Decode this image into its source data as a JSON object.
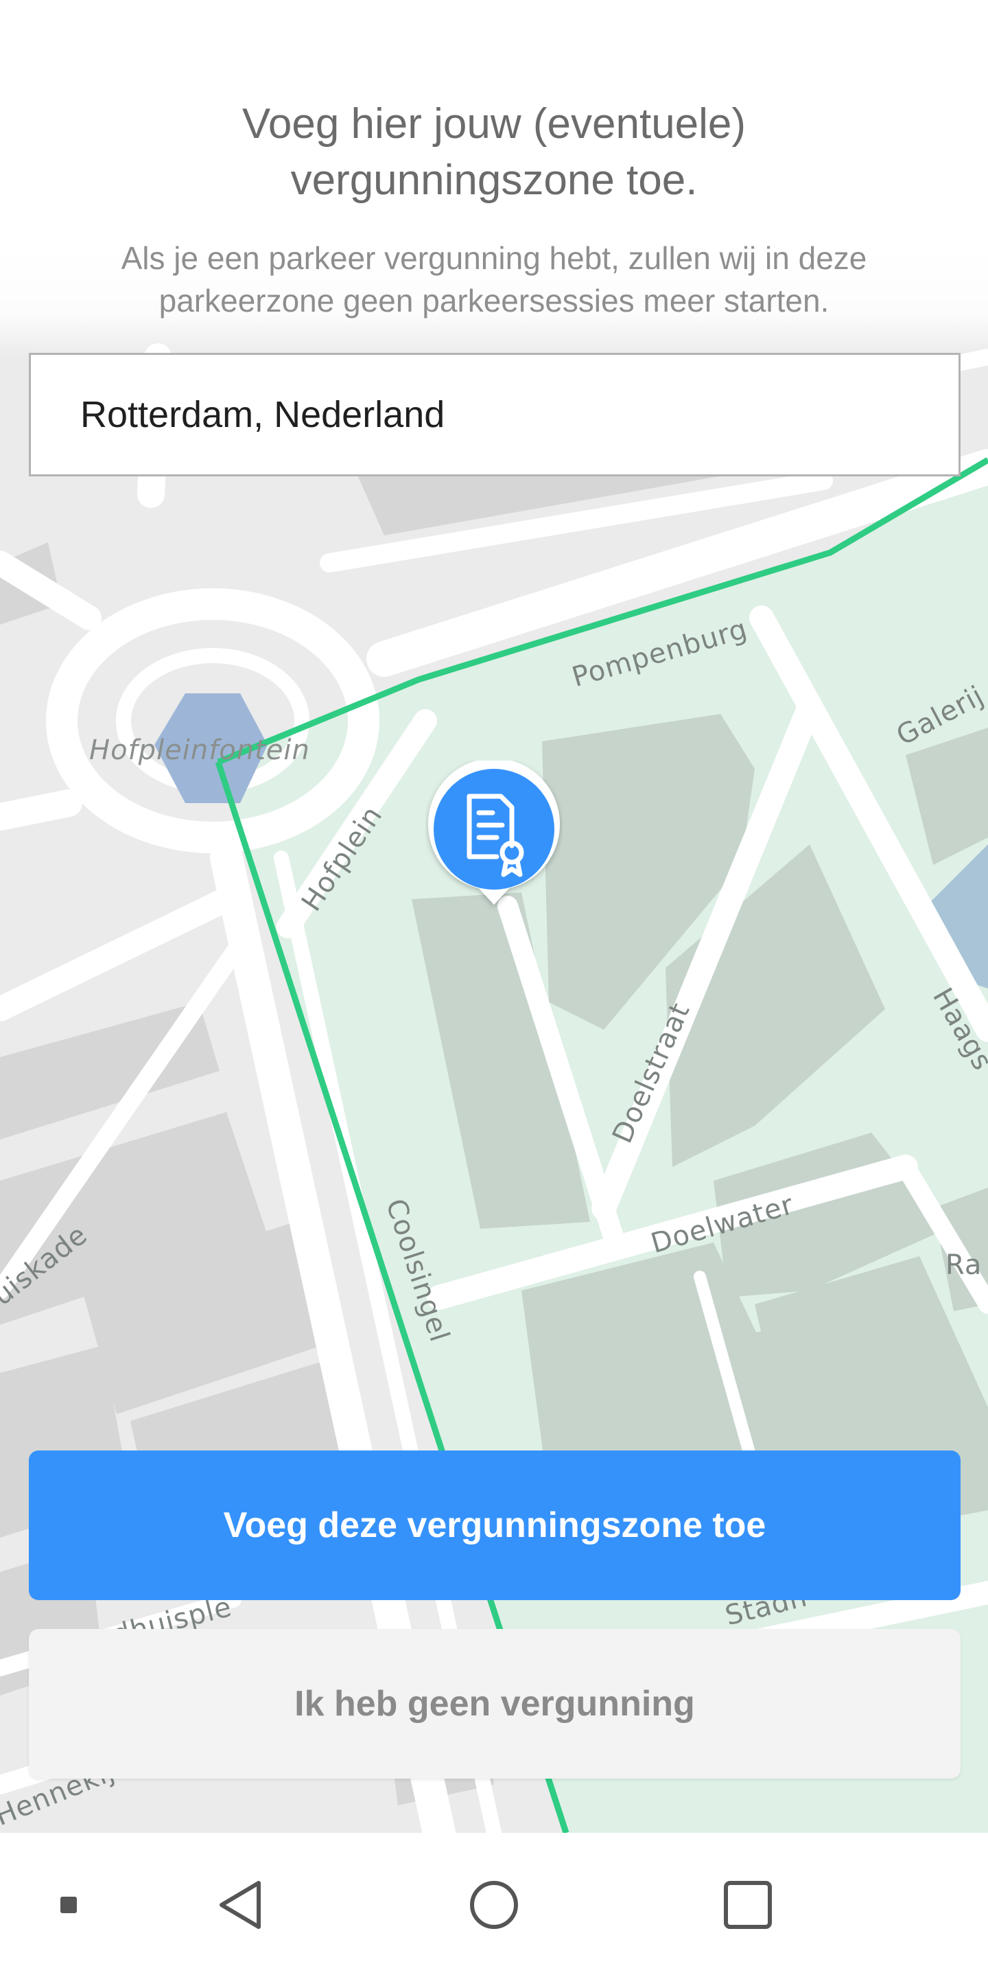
{
  "header": {
    "title": "Voeg hier jouw (eventuele) vergunningszone toe.",
    "subtitle": "Als je een parkeer vergunning hebt, zullen wij in deze parkeerzone geen parkeersessies meer starten."
  },
  "search": {
    "value": "Rotterdam, Nederland"
  },
  "map": {
    "labels": {
      "pompenburg": "Pompenburg",
      "galerij": "Galerij",
      "hofpleinfontein": "Hofpleinfontein",
      "hofplein": "Hofplein",
      "doelstraat": "Doelstraat",
      "haagseveer": "Haags",
      "doelwater": "Doelwater",
      "coolsingel": "Coolsingel",
      "weena": "uiskade",
      "raam": "Ra",
      "stadhuisplein": "dhuisple",
      "stadhuis": "Stadh",
      "hennekijn": "Hennekij"
    },
    "zone_color": "#2ecc85",
    "marker": {
      "icon": "permit-certificate-icon",
      "color": "#3592fb"
    }
  },
  "actions": {
    "add_zone": "Voeg deze vergunningszone toe",
    "no_permit": "Ik heb geen vergunning"
  },
  "navbar": {
    "icons": [
      "menu-dot-icon",
      "back-triangle-icon",
      "home-circle-icon",
      "recents-square-icon"
    ]
  }
}
